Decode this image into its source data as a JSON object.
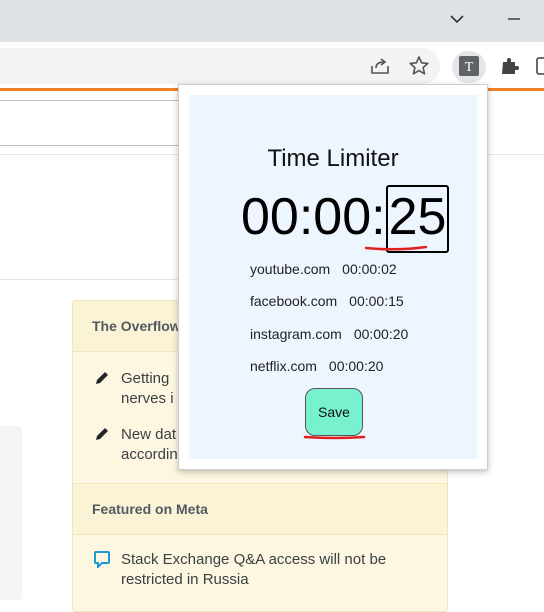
{
  "popup": {
    "title": "Time Limiter",
    "timer": {
      "hours_minutes": "00:00:",
      "seconds": "25"
    },
    "sites": [
      {
        "domain": "youtube.com",
        "time": "00:00:02"
      },
      {
        "domain": "facebook.com",
        "time": "00:00:15"
      },
      {
        "domain": "instagram.com",
        "time": "00:00:20"
      },
      {
        "domain": "netflix.com",
        "time": "00:00:20"
      }
    ],
    "save_label": "Save",
    "colors": {
      "background": "#edf5fe",
      "save_button": "#78f1cf",
      "annotation": "#e0201e"
    }
  },
  "sidebar": {
    "overflow_heading": "The Overflow",
    "overflow_items": [
      {
        "line1": "Getting",
        "line2": "nerves i"
      },
      {
        "line1": "New dat",
        "line2": "accordin"
      }
    ],
    "meta_heading": "Featured on Meta",
    "meta_items": [
      {
        "line1": "Stack Exchange Q&A access will not be",
        "line2": "restricted in Russia"
      }
    ]
  },
  "icons": {
    "tabstrip": [
      "chevron-down-icon",
      "minimize-icon"
    ],
    "toolbar": [
      "share-icon",
      "bookmark-star-icon",
      "extension-t-icon",
      "puzzle-icon",
      "sidepanel-icon"
    ]
  },
  "colors": {
    "accent_line": "#f48024",
    "sidebar_bg": "#fdf7e2"
  }
}
